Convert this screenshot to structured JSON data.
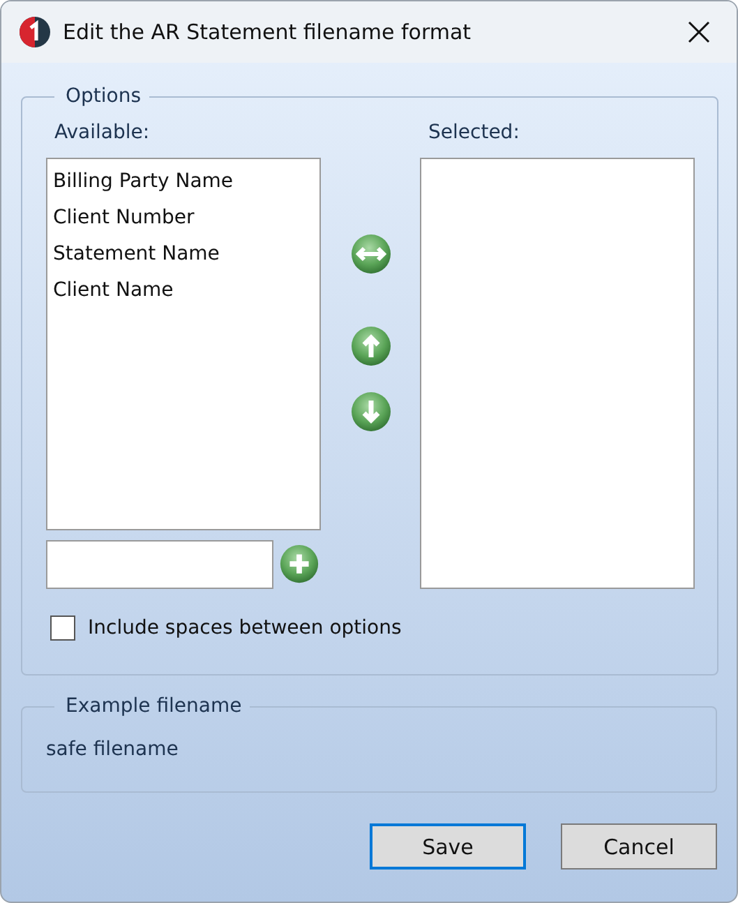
{
  "window": {
    "title": "Edit the AR Statement filename format"
  },
  "options": {
    "legend": "Options",
    "available_label": "Available:",
    "selected_label": "Selected:",
    "available": [
      {
        "label": "Billing Party Name",
        "selected": false
      },
      {
        "label": "Client Number",
        "selected": false
      },
      {
        "label": "Statement Name",
        "selected": false
      },
      {
        "label": "Client Name",
        "selected": false
      }
    ],
    "include_spaces": {
      "label": "Include spaces between options",
      "checked": false
    }
  },
  "example": {
    "legend": "Example filename",
    "value": "safe filename"
  },
  "buttons": [
    {
      "label": "Save",
      "kind": "default"
    },
    {
      "label": "Cancel",
      "kind": "normal"
    }
  ]
}
